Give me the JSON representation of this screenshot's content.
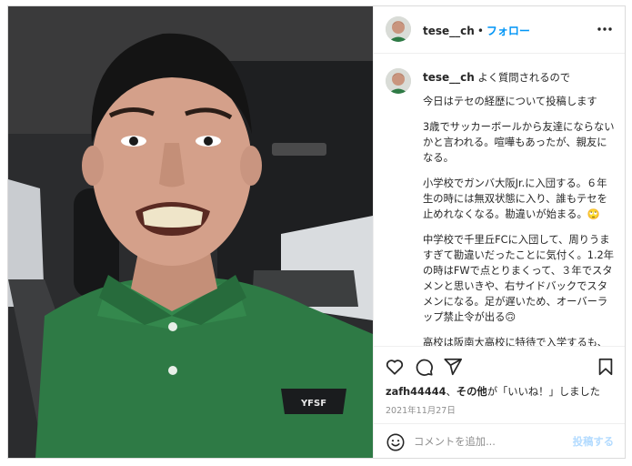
{
  "header": {
    "username": "tese__ch",
    "separator": "•",
    "follow_label": "フォロー",
    "more_icon": "more-horizontal-icon"
  },
  "caption": {
    "username": "tese__ch",
    "paragraphs": [
      "よく質問されるので",
      "今日はテセの経歴について投稿します",
      "3歳でサッカーボールから友達にならないかと言われる。喧嘩もあったが、親友になる。",
      "小学校でガンバ大阪Jr.に入団する。６年生の時には無双状態に入り、誰もテセを止めれなくなる。勘違いが始まる。🙄",
      "中学校で千里丘FCに入団して、周りうますぎて勘違いだったことに気付く。1.2年の時はFWで点とりまくって、３年でスタメンと思いきや、右サイドバックでスタメンになる。足が遅いため、オーバーラップ禁止令が出る🙃",
      "高校は阪南大高校に特待で入学するも、"
    ]
  },
  "photo": {
    "shirt_logo": "YFSF"
  },
  "actions": {
    "like_icon": "heart-icon",
    "comment_icon": "comment-icon",
    "share_icon": "send-icon",
    "save_icon": "bookmark-icon"
  },
  "likes": {
    "user": "zafh44444",
    "sep": "、",
    "others": "その他",
    "suffix": "が「いいね！」しました"
  },
  "date": "2021年11月27日",
  "comment": {
    "placeholder": "コメントを追加...",
    "post_label": "投稿する",
    "emoji_icon": "smiley-icon"
  },
  "colors": {
    "accent": "#0095f6",
    "post_disabled": "#b3dbff",
    "text": "#262626",
    "muted": "#8e8e8e",
    "border": "#dbdbdb",
    "shirt": "#2e7a45"
  }
}
